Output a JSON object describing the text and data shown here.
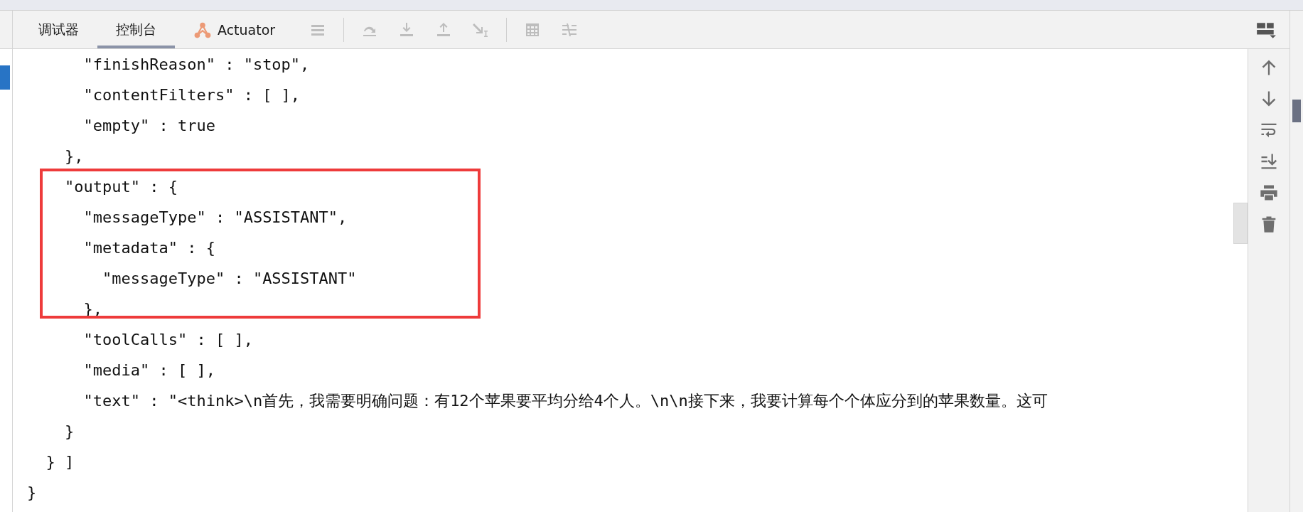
{
  "tabs": [
    {
      "label": "调试器",
      "selected": false,
      "kind": "plain"
    },
    {
      "label": "控制台",
      "selected": true,
      "kind": "plain"
    },
    {
      "label": "Actuator",
      "selected": false,
      "kind": "actuator"
    }
  ],
  "console": {
    "lines_before": [
      "      \"finishReason\" : \"stop\",",
      "      \"contentFilters\" : [ ],",
      "      \"empty\" : true",
      "    },"
    ],
    "highlighted_lines": [
      "    \"output\" : {",
      "      \"messageType\" : \"ASSISTANT\",",
      "      \"metadata\" : {",
      "        \"messageType\" : \"ASSISTANT\"",
      "      },"
    ],
    "lines_after": [
      "      \"toolCalls\" : [ ],",
      "      \"media\" : [ ],",
      "      \"text\" : \"<think>\\n首先，我需要明确问题：有12个苹果要平均分给4个人。\\n\\n接下来，我要计算每个个体应分到的苹果数量。这可",
      "    }",
      "  } ]",
      "}"
    ]
  }
}
